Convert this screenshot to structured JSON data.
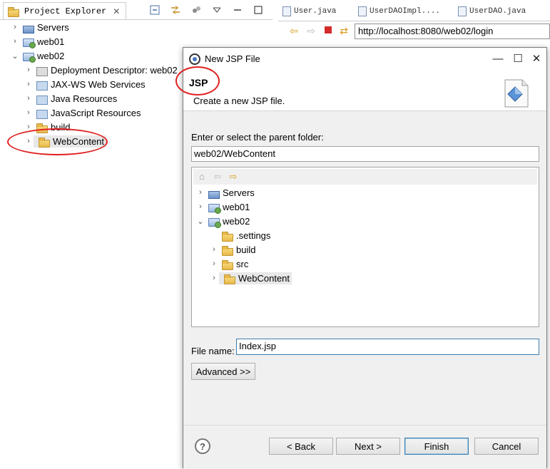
{
  "explorer": {
    "tab_label": "Project Explorer",
    "tab_close": "✕",
    "items": [
      {
        "label": "Servers",
        "chev": "›",
        "icon": "servers-folder-icon"
      },
      {
        "label": "web01",
        "chev": "›",
        "icon": "web-project-icon"
      },
      {
        "label": "web02",
        "chev": "⌄",
        "icon": "web-project-icon"
      },
      {
        "label": "Deployment Descriptor: web02",
        "chev": "›",
        "icon": "deployment-descriptor-icon"
      },
      {
        "label": "JAX-WS Web Services",
        "chev": "›",
        "icon": "web-services-icon"
      },
      {
        "label": "Java Resources",
        "chev": "›",
        "icon": "java-resources-icon"
      },
      {
        "label": "JavaScript Resources",
        "chev": "›",
        "icon": "javascript-resources-icon"
      },
      {
        "label": "build",
        "chev": "›",
        "icon": "folder-icon"
      },
      {
        "label": "WebContent",
        "chev": "›",
        "icon": "open-folder-icon"
      }
    ]
  },
  "editor": {
    "tabs": [
      "User.java",
      "UserDAOImpl....",
      "UserDAO.java"
    ],
    "url": "http://localhost:8080/web02/login"
  },
  "dialog": {
    "title": "New JSP File",
    "minimize": "—",
    "maximize": "☐",
    "close": "✕",
    "header_title": "JSP",
    "header_desc": "Create a new JSP file.",
    "parent_label": "Enter or select the parent folder:",
    "parent_value": "web02/WebContent",
    "tree": [
      {
        "label": "Servers",
        "chev": "›"
      },
      {
        "label": "web01",
        "chev": "›"
      },
      {
        "label": "web02",
        "chev": "⌄"
      },
      {
        "label": ".settings",
        "chev": ""
      },
      {
        "label": "build",
        "chev": "›"
      },
      {
        "label": "src",
        "chev": "›"
      },
      {
        "label": "WebContent",
        "chev": "›"
      }
    ],
    "filename_label": "File name:",
    "filename_value": "Index.jsp",
    "advanced": "Advanced >>",
    "help": "?",
    "back": "< Back",
    "next": "Next >",
    "finish": "Finish",
    "cancel": "Cancel"
  },
  "colors": {
    "annotation": "#e02020",
    "selection": "#e8e8e8",
    "focus": "#3c7fb1"
  }
}
